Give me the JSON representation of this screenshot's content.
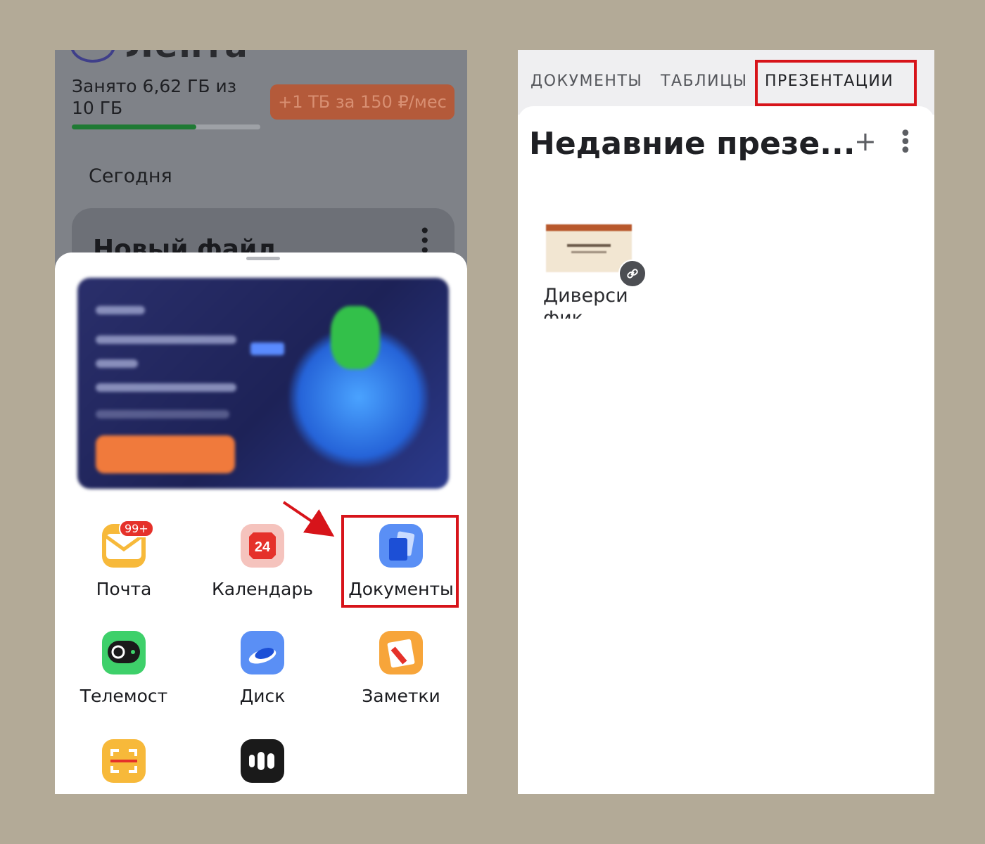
{
  "left_screen": {
    "storage_text": "Занято 6,62 ГБ из 10 ГБ",
    "storage_fraction": 0.66,
    "upgrade_button": "+1 ТБ за 150 ₽/мес",
    "today_label": "Сегодня",
    "file_card_name": "Новый файл",
    "apps": [
      {
        "label": "Почта",
        "icon": "mail-icon",
        "badge": "99+",
        "color": "#f7b93a"
      },
      {
        "label": "Календарь",
        "icon": "calendar-icon",
        "day": "24",
        "color": "#f5b8b3"
      },
      {
        "label": "Документы",
        "icon": "documents-icon",
        "color": "#5a8ff5"
      },
      {
        "label": "Телемост",
        "icon": "telemost-icon",
        "color": "#3ed06a"
      },
      {
        "label": "Диск",
        "icon": "disk-icon",
        "color": "#5a8ff5"
      },
      {
        "label": "Заметки",
        "icon": "notes-icon",
        "color": "#f7a53a"
      },
      {
        "label": "",
        "icon": "scanner-icon",
        "color": "#f7b93a"
      },
      {
        "label": "",
        "icon": "music-icon",
        "color": "#1a1a1a"
      }
    ],
    "highlight_color": "#d7141a"
  },
  "right_screen": {
    "tabs": [
      "ДОКУМЕНТЫ",
      "ТАБЛИЦЫ",
      "ПРЕЗЕНТАЦИИ"
    ],
    "active_tab": "ПРЕЗЕНТАЦИИ",
    "recent_title": "Недавние презе...",
    "plus": "+",
    "kebab": "⋮",
    "file_label": "Диверсифик"
  }
}
